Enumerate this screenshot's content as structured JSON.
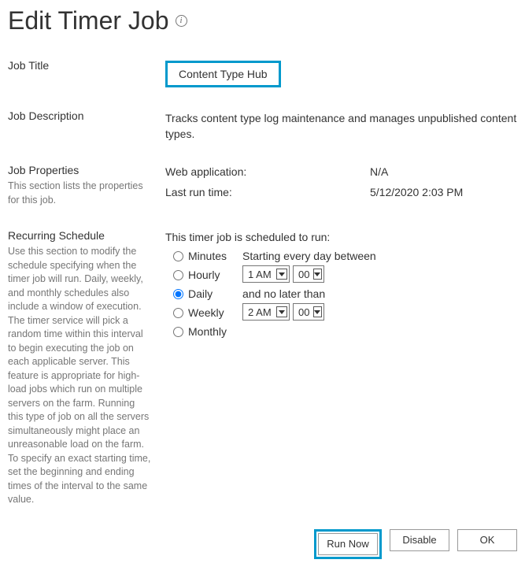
{
  "header": {
    "title": "Edit Timer Job"
  },
  "sections": {
    "title": {
      "label": "Job Title",
      "value": "Content Type Hub"
    },
    "description": {
      "label": "Job Description",
      "value": "Tracks content type log maintenance and manages unpublished content types."
    },
    "properties": {
      "label": "Job Properties",
      "help": "This section lists the properties for this job.",
      "items": [
        {
          "label": "Web application:",
          "value": "N/A"
        },
        {
          "label": "Last run time:",
          "value": "5/12/2020 2:03 PM"
        }
      ]
    },
    "schedule": {
      "label": "Recurring Schedule",
      "help": "Use this section to modify the schedule specifying when the timer job will run. Daily, weekly, and monthly schedules also include a window of execution. The timer service will pick a random time within this interval to begin executing the job on each applicable server. This feature is appropriate for high-load jobs which run on multiple servers on the farm. Running this type of job on all the servers simultaneously might place an unreasonable load on the farm. To specify an exact starting time, set the beginning and ending times of the interval to the same value.",
      "intro": "This timer job is scheduled to run:",
      "options": [
        "Minutes",
        "Hourly",
        "Daily",
        "Weekly",
        "Monthly"
      ],
      "selected": "Daily",
      "start_label": "Starting every day between",
      "end_label": "and no later than",
      "start_hour": "1 AM",
      "start_min": "00",
      "end_hour": "2 AM",
      "end_min": "00"
    }
  },
  "buttons": {
    "run_now": "Run Now",
    "disable": "Disable",
    "ok": "OK"
  }
}
